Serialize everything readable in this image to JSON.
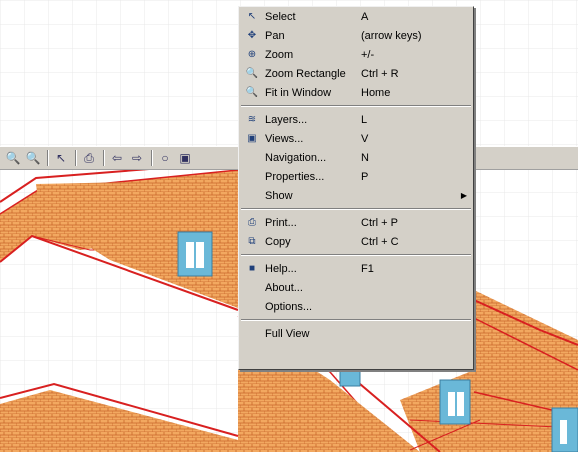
{
  "menu": {
    "groups": [
      [
        {
          "name": "menu-item-select",
          "icon": "cursor-icon",
          "glyph": "↖",
          "label": "Select",
          "shortcut": "A"
        },
        {
          "name": "menu-item-pan",
          "icon": "pan-icon",
          "glyph": "✥",
          "label": "Pan",
          "shortcut": "(arrow keys)"
        },
        {
          "name": "menu-item-zoom",
          "icon": "zoom-icon",
          "glyph": "⊕",
          "label": "Zoom",
          "shortcut": "+/-"
        },
        {
          "name": "menu-item-zoom-rectangle",
          "icon": "zoom-rectangle-icon",
          "glyph": "🔍",
          "label": "Zoom Rectangle",
          "shortcut": "Ctrl + R"
        },
        {
          "name": "menu-item-fit-in-window",
          "icon": "fit-window-icon",
          "glyph": "🔍",
          "label": "Fit in Window",
          "shortcut": "Home"
        }
      ],
      [
        {
          "name": "menu-item-layers",
          "icon": "layers-icon",
          "glyph": "≋",
          "label": "Layers...",
          "shortcut": "L"
        },
        {
          "name": "menu-item-views",
          "icon": "views-icon",
          "glyph": "▣",
          "label": "Views...",
          "shortcut": "V"
        },
        {
          "name": "menu-item-navigation",
          "icon": "",
          "glyph": "",
          "label": "Navigation...",
          "shortcut": "N"
        },
        {
          "name": "menu-item-properties",
          "icon": "",
          "glyph": "",
          "label": "Properties...",
          "shortcut": "P"
        },
        {
          "name": "menu-item-show",
          "icon": "",
          "glyph": "",
          "label": "Show",
          "shortcut": "",
          "submenu": true
        }
      ],
      [
        {
          "name": "menu-item-print",
          "icon": "printer-icon",
          "glyph": "⎙",
          "label": "Print...",
          "shortcut": "Ctrl + P"
        },
        {
          "name": "menu-item-copy",
          "icon": "copy-icon",
          "glyph": "⧉",
          "label": "Copy",
          "shortcut": "Ctrl + C"
        }
      ],
      [
        {
          "name": "menu-item-help",
          "icon": "help-icon",
          "glyph": "■",
          "label": "Help...",
          "shortcut": "F1"
        },
        {
          "name": "menu-item-about",
          "icon": "",
          "glyph": "",
          "label": "About...",
          "shortcut": ""
        },
        {
          "name": "menu-item-options",
          "icon": "",
          "glyph": "",
          "label": "Options...",
          "shortcut": ""
        }
      ],
      [
        {
          "name": "menu-item-full-view",
          "icon": "",
          "glyph": "",
          "label": "Full View",
          "shortcut": ""
        }
      ]
    ],
    "submenu_arrow": "▶"
  },
  "toolbar": {
    "buttons": [
      {
        "name": "zoom-in-tool-button",
        "icon": "zoom-in-icon",
        "glyph": "🔍"
      },
      {
        "name": "zoom-rect-tool-button",
        "icon": "zoom-rectangle-icon",
        "glyph": "🔍"
      },
      {
        "sep": true
      },
      {
        "name": "select-tool-button",
        "icon": "cursor-icon",
        "glyph": "↖"
      },
      {
        "sep": true
      },
      {
        "name": "print-tool-button",
        "icon": "printer-icon",
        "glyph": "⎙"
      },
      {
        "sep": true
      },
      {
        "name": "back-tool-button",
        "icon": "arrow-left-icon",
        "glyph": "⇦"
      },
      {
        "name": "forward-tool-button",
        "icon": "arrow-right-icon",
        "glyph": "⇨"
      },
      {
        "sep": true
      },
      {
        "name": "stop-tool-button",
        "icon": "circle-icon",
        "glyph": "○"
      },
      {
        "name": "view-tool-button",
        "icon": "view-icon",
        "glyph": "▣"
      }
    ]
  },
  "colors": {
    "roof_fill": "#f0b070",
    "roof_line": "#d82020",
    "brick": "#e08a3a",
    "window_frame": "#6ab8d8",
    "menu_bg": "#d4d0c8",
    "grid": "#e6e6e6"
  }
}
